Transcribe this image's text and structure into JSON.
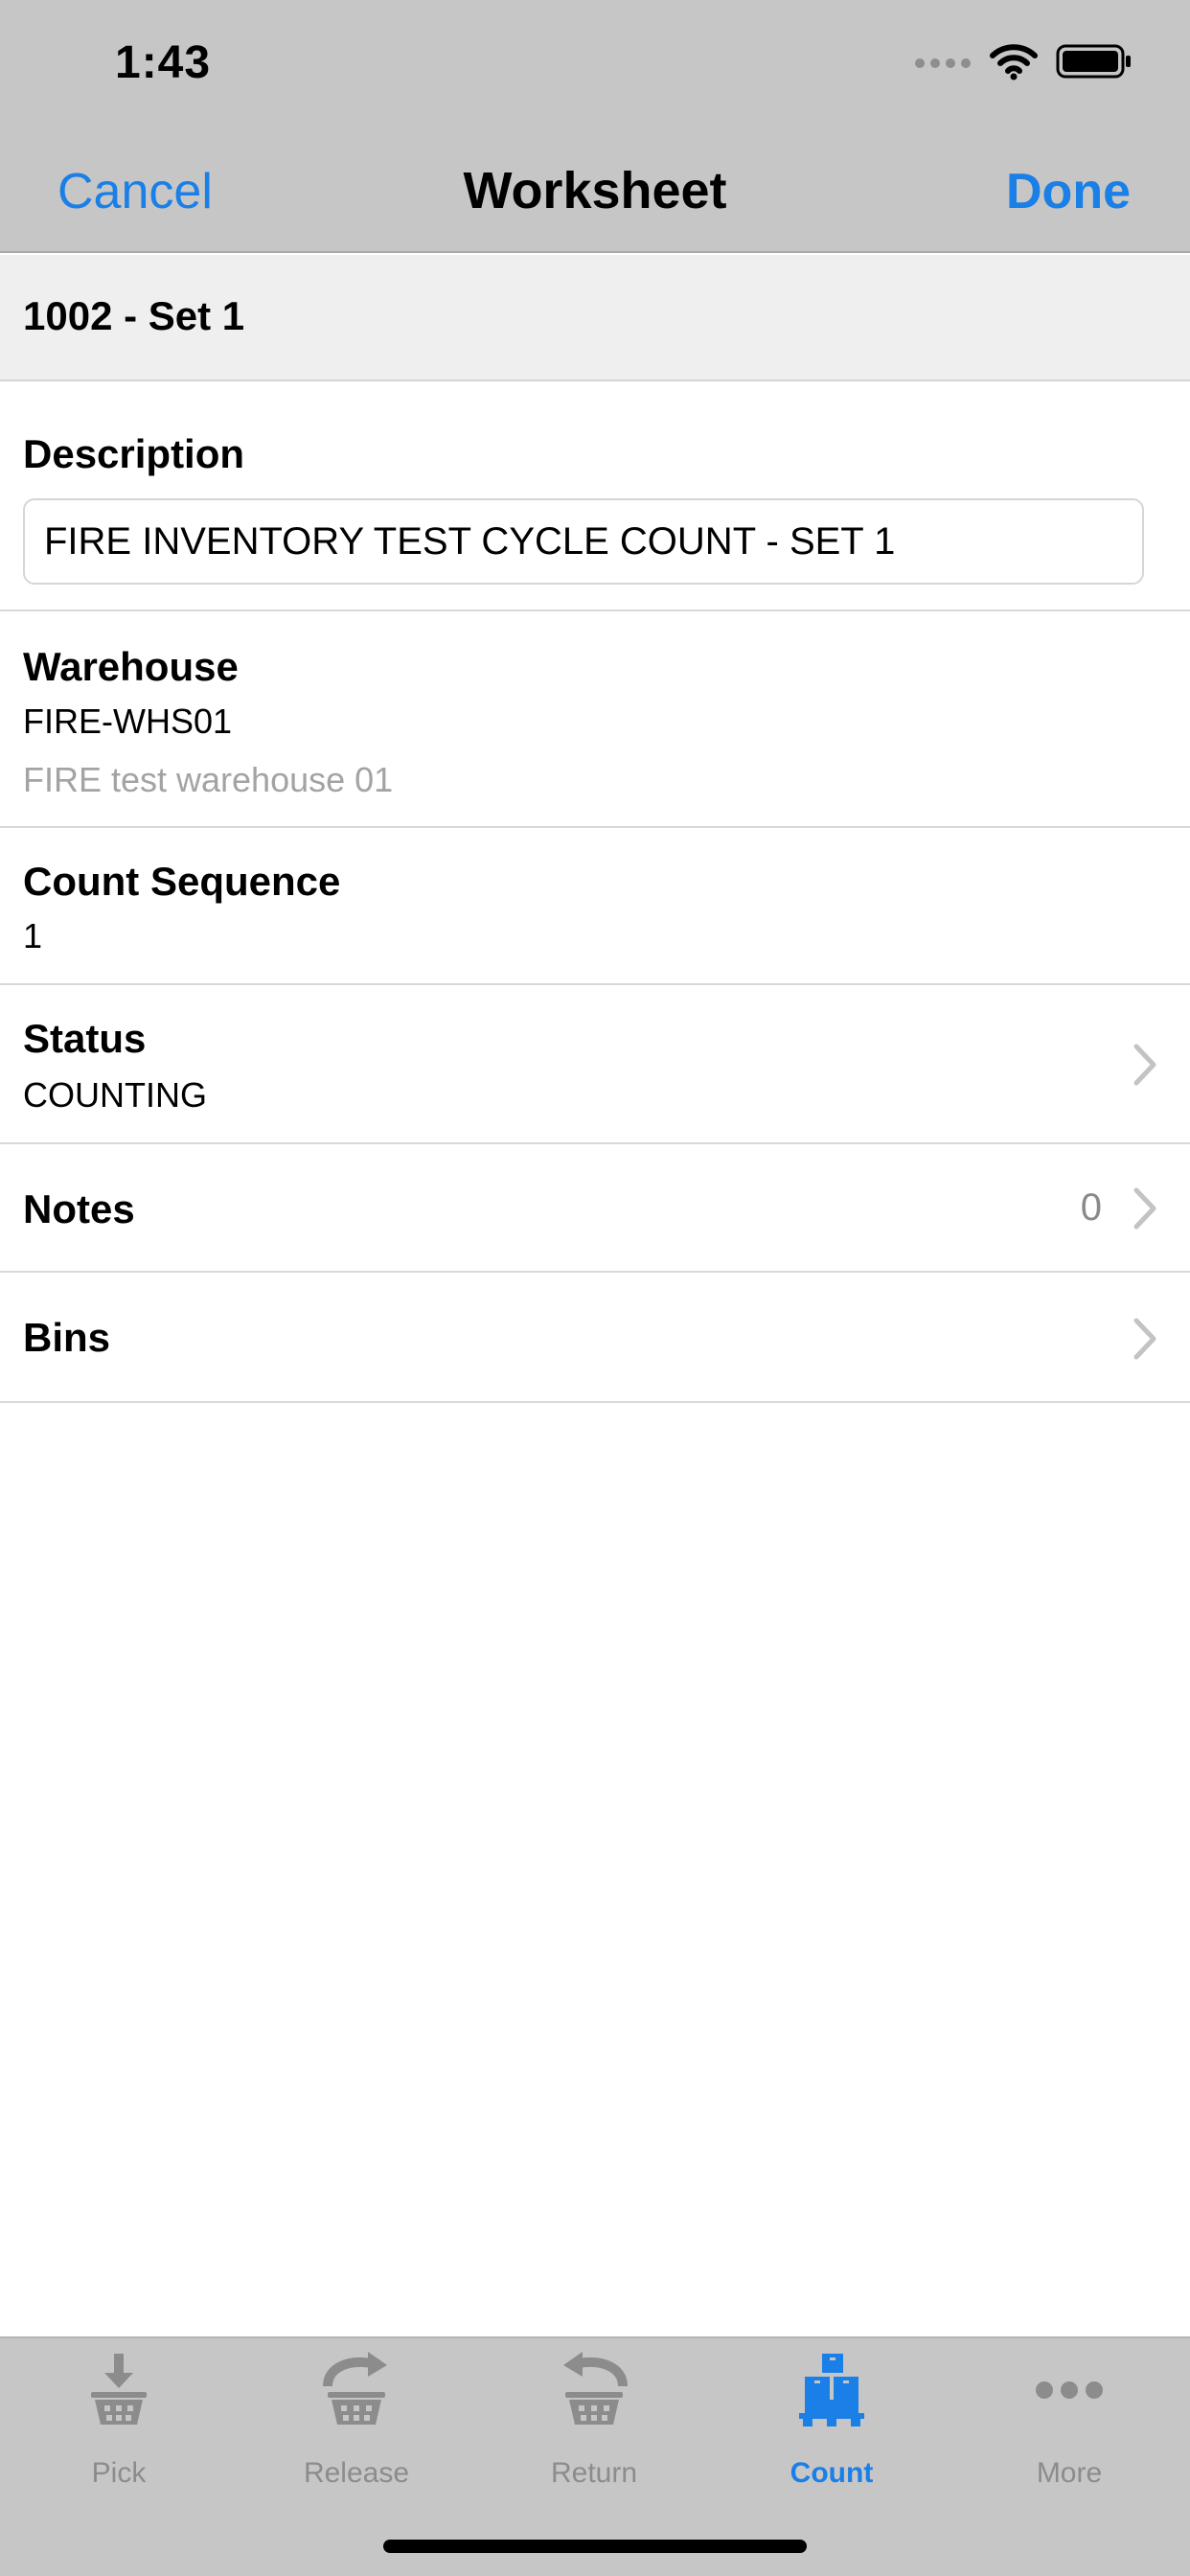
{
  "status_bar": {
    "time": "1:43"
  },
  "nav": {
    "cancel_label": "Cancel",
    "title": "Worksheet",
    "done_label": "Done"
  },
  "header": {
    "title": "1002 - Set 1"
  },
  "fields": {
    "description": {
      "label": "Description",
      "value": "FIRE INVENTORY TEST CYCLE COUNT - SET 1"
    },
    "warehouse": {
      "label": "Warehouse",
      "value": "FIRE-WHS01",
      "subtitle": "FIRE test warehouse 01"
    },
    "count_sequence": {
      "label": "Count Sequence",
      "value": "1"
    },
    "status": {
      "label": "Status",
      "value": "COUNTING"
    },
    "notes": {
      "label": "Notes",
      "count": "0"
    },
    "bins": {
      "label": "Bins"
    }
  },
  "tabs": [
    {
      "label": "Pick",
      "icon": "pick-basket-icon",
      "active": false
    },
    {
      "label": "Release",
      "icon": "release-basket-icon",
      "active": false
    },
    {
      "label": "Return",
      "icon": "return-basket-icon",
      "active": false
    },
    {
      "label": "Count",
      "icon": "count-pallet-icon",
      "active": true
    },
    {
      "label": "More",
      "icon": "more-dots-icon",
      "active": false
    }
  ],
  "colors": {
    "accent": "#1a7fe6",
    "bar_background": "#c6c6c6",
    "inactive_tab": "#8c8c8c"
  }
}
